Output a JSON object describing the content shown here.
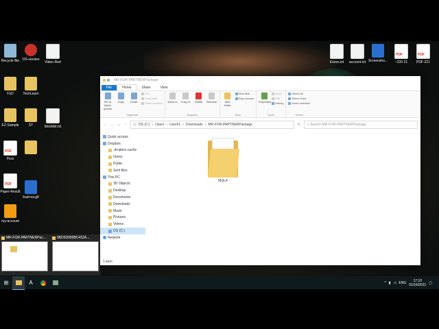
{
  "desktop": {
    "left_icons": [
      {
        "label": "Recycle Bin",
        "type": "bin"
      },
      {
        "label": "OS-version",
        "type": "red"
      },
      {
        "label": "Video-Red",
        "type": "doc"
      },
      {
        "label": "FoD",
        "type": "fold"
      },
      {
        "label": "TechLearn",
        "type": "fold"
      },
      {
        "label": "EZ-Sample",
        "type": "fold"
      },
      {
        "label": "ST",
        "type": "fold"
      },
      {
        "label": "blocklist.txt",
        "type": "doc"
      },
      {
        "label": "Pxxx",
        "type": "pdf"
      },
      {
        "label": "",
        "type": "fold"
      },
      {
        "label": "Paper-Result",
        "type": "pdf"
      },
      {
        "label": "load-ea.gif",
        "type": "blu"
      },
      {
        "label": "my-account",
        "type": "sub"
      }
    ],
    "top_right_icons": [
      {
        "label": "Exees.txt",
        "type": "doc"
      },
      {
        "label": "account.txt",
        "type": "doc"
      },
      {
        "label": "Screensho...",
        "type": "blu"
      },
      {
        "label": "~220 21",
        "type": "pdf"
      },
      {
        "label": "PDF-221",
        "type": "pdf"
      }
    ]
  },
  "window": {
    "path_title": "MR-FOR-PARTNERPackage",
    "tabs": [
      "File",
      "Home",
      "Share",
      "View"
    ],
    "ribbon": {
      "clipboard": {
        "name": "Clipboard",
        "pin": "Pin to Quick access",
        "copy": "Copy",
        "paste": "Paste",
        "cut": "Cut",
        "copy_path": "Copy path",
        "paste_shortcut": "Paste shortcut"
      },
      "organize": {
        "name": "Organize",
        "move_to": "Move to",
        "copy_to": "Copy to",
        "delete": "Delete",
        "rename": "Rename"
      },
      "new": {
        "name": "New",
        "new_item": "New item",
        "easy_access": "Easy access",
        "new_folder": "New folder"
      },
      "open": {
        "name": "Open",
        "properties": "Properties",
        "open": "Open",
        "edit": "Edit",
        "history": "History"
      },
      "select": {
        "name": "Select",
        "select_all": "Select all",
        "select_none": "Select none",
        "invert": "Invert selection"
      }
    },
    "address": {
      "crumbs": [
        "OS (C:)",
        "Users",
        "User01",
        "Downloads",
        "MR-FOR-PARTNERPackage"
      ],
      "search_placeholder": "Search MR-FOR-PARTNERPackage"
    },
    "nav_pane": [
      {
        "label": "Quick access",
        "icon": "star-icon"
      },
      {
        "label": "Dropbox",
        "icon": "dropbox-icon"
      },
      {
        "label": ".dropbox.cache",
        "icon": "folder-icon"
      },
      {
        "label": "honey",
        "icon": "folder-icon"
      },
      {
        "label": "Public",
        "icon": "folder-icon"
      },
      {
        "label": "Sent files",
        "icon": "folder-icon"
      },
      {
        "label": "This PC",
        "icon": "pc-icon"
      },
      {
        "label": "3D Objects",
        "icon": "folder-icon"
      },
      {
        "label": "Desktop",
        "icon": "folder-icon"
      },
      {
        "label": "Documents",
        "icon": "folder-icon"
      },
      {
        "label": "Downloads",
        "icon": "folder-icon"
      },
      {
        "label": "Music",
        "icon": "folder-icon"
      },
      {
        "label": "Pictures",
        "icon": "folder-icon"
      },
      {
        "label": "Videos",
        "icon": "folder-icon"
      },
      {
        "label": "OS (C:)",
        "icon": "drive-icon"
      },
      {
        "label": "Network",
        "icon": "network-icon"
      }
    ],
    "files": [
      {
        "name": "MQL4"
      }
    ],
    "status": "1 item"
  },
  "thumbnails": [
    {
      "title": "MR-FOR-PARTNERPac..."
    },
    {
      "title": "6BD5D999BC432A..."
    }
  ],
  "taskbar": {
    "lang": "ENG",
    "time": "17:10",
    "date": "01/16/2021"
  }
}
